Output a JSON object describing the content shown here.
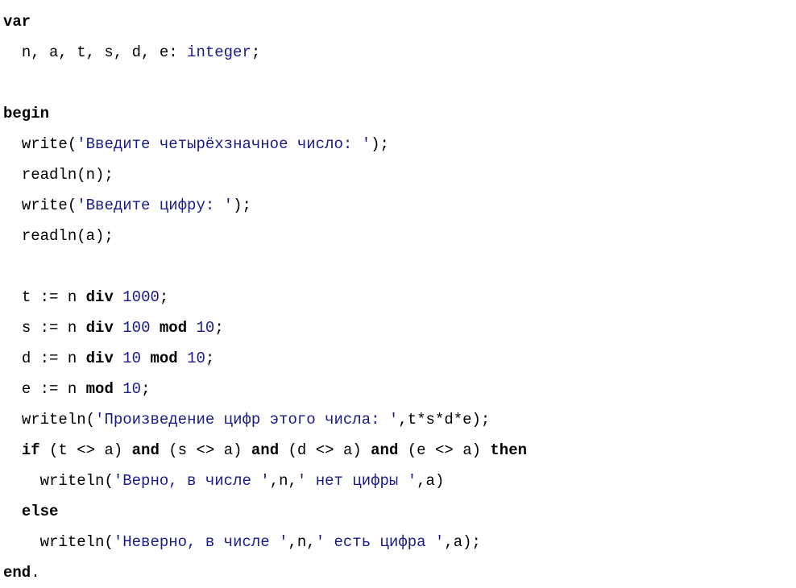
{
  "code": {
    "l01_var": "var",
    "l02_indent": "  ",
    "l02_decl": "n, a, t, s, d, e: ",
    "l02_type": "integer",
    "l02_semi": ";",
    "l04_begin": "begin",
    "l05_indent": "  ",
    "l05_write": "write",
    "l05_open": "(",
    "l05_str": "'Введите четырёхзначное число: '",
    "l05_close": ");",
    "l06_indent": "  ",
    "l06_readln": "readln",
    "l06_arg": "(n);",
    "l07_indent": "  ",
    "l07_write": "write",
    "l07_open": "(",
    "l07_str": "'Введите цифру: '",
    "l07_close": ");",
    "l08_indent": "  ",
    "l08_readln": "readln",
    "l08_arg": "(a);",
    "l10_indent": "  ",
    "l10_lhs": "t := n ",
    "l10_div": "div",
    "l10_sp": " ",
    "l10_num": "1000",
    "l10_semi": ";",
    "l11_indent": "  ",
    "l11_lhs": "s := n ",
    "l11_div": "div",
    "l11_sp1": " ",
    "l11_num1": "100",
    "l11_sp2": " ",
    "l11_mod": "mod",
    "l11_sp3": " ",
    "l11_num2": "10",
    "l11_semi": ";",
    "l12_indent": "  ",
    "l12_lhs": "d := n ",
    "l12_div": "div",
    "l12_sp1": " ",
    "l12_num1": "10",
    "l12_sp2": " ",
    "l12_mod": "mod",
    "l12_sp3": " ",
    "l12_num2": "10",
    "l12_semi": ";",
    "l13_indent": "  ",
    "l13_lhs": "e := n ",
    "l13_mod": "mod",
    "l13_sp": " ",
    "l13_num": "10",
    "l13_semi": ";",
    "l14_indent": "  ",
    "l14_writeln": "writeln",
    "l14_open": "(",
    "l14_str": "'Произведение цифр этого числа: '",
    "l14_rest": ",t*s*d*e);",
    "l15_indent": "  ",
    "l15_if": "if",
    "l15_sp1": " (t <> a) ",
    "l15_and1": "and",
    "l15_sp2": " (s <> a) ",
    "l15_and2": "and",
    "l15_sp3": " (d <> a) ",
    "l15_and3": "and",
    "l15_sp4": " (e <> a) ",
    "l15_then": "then",
    "l16_indent": "    ",
    "l16_writeln": "writeln",
    "l16_open": "(",
    "l16_str1": "'Верно, в числе '",
    "l16_mid": ",n,",
    "l16_str2": "' нет цифры '",
    "l16_close": ",a)",
    "l17_indent": "  ",
    "l17_else": "else",
    "l18_indent": "    ",
    "l18_writeln": "writeln",
    "l18_open": "(",
    "l18_str1": "'Неверно, в числе '",
    "l18_mid": ",n,",
    "l18_str2": "' есть цифра '",
    "l18_close": ",a);",
    "l19_end": "end",
    "l19_dot": "."
  }
}
